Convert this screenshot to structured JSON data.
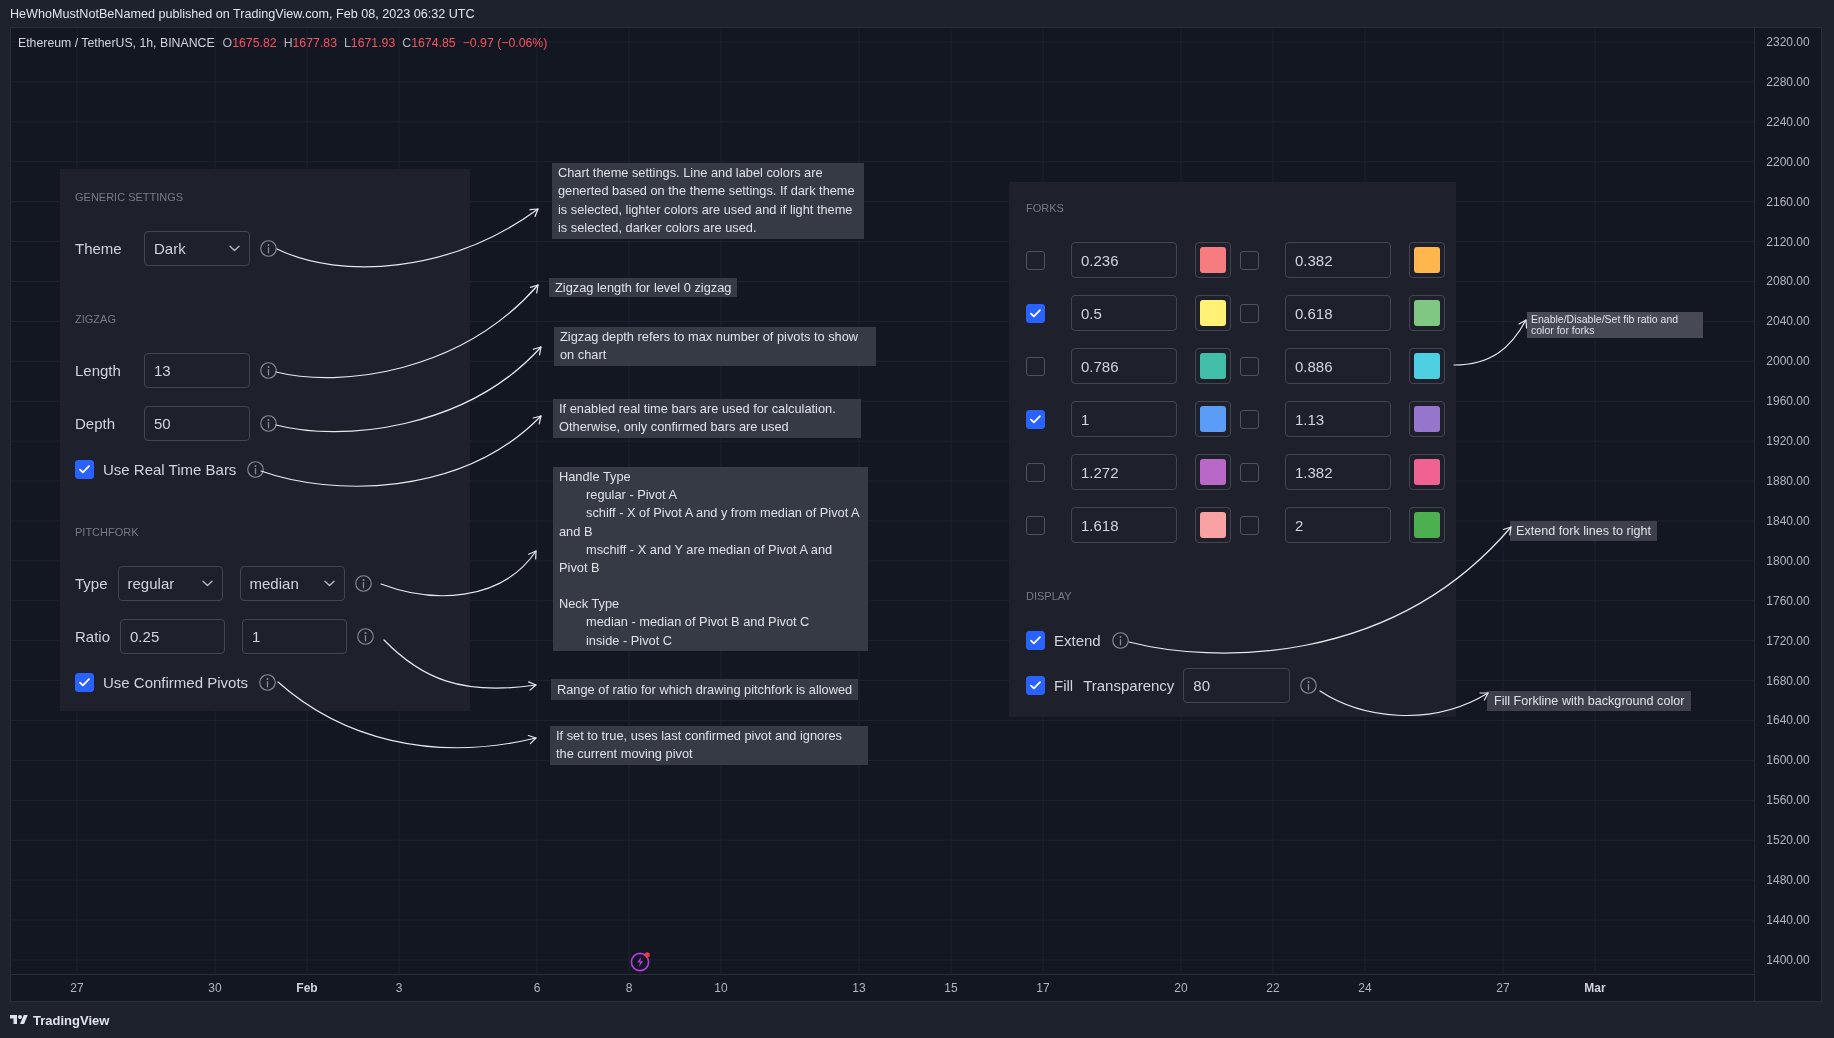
{
  "header": {
    "text": "HeWhoMustNotBeNamed published on TradingView.com, Feb 08, 2023 06:32 UTC"
  },
  "chart": {
    "legend": {
      "symbol": "Ethereum / TetherUS, 1h, BINANCE",
      "values": [
        {
          "label": "O",
          "value": "1675.82"
        },
        {
          "label": "H",
          "value": "1677.83"
        },
        {
          "label": "L",
          "value": "1671.93"
        },
        {
          "label": "C",
          "value": "1674.85"
        }
      ],
      "change": "−0.97 (−0.06%)"
    },
    "settings_panel": {
      "sections": [
        {
          "title": "GENERIC SETTINGS",
          "rows": [
            {
              "kind": "fields",
              "label": "Theme",
              "controls": [
                {
                  "kind": "select",
                  "value": "Dark"
                }
              ]
            }
          ]
        },
        {
          "title": "ZIGZAG",
          "rows": [
            {
              "kind": "fields",
              "label": "Length",
              "controls": [
                {
                  "kind": "input",
                  "value": "13"
                }
              ]
            },
            {
              "kind": "fields",
              "label": "Depth",
              "controls": [
                {
                  "kind": "input",
                  "value": "50"
                }
              ]
            },
            {
              "kind": "checkbox",
              "label": "Use Real Time Bars",
              "checked": true
            }
          ]
        },
        {
          "title": "PITCHFORK",
          "rows": [
            {
              "kind": "fields",
              "label": "Type",
              "controls": [
                {
                  "kind": "select",
                  "value": "regular"
                },
                {
                  "kind": "select",
                  "value": "median"
                }
              ]
            },
            {
              "kind": "fields",
              "label": "Ratio",
              "controls": [
                {
                  "kind": "input",
                  "value": "0.25"
                },
                {
                  "kind": "input",
                  "value": "1"
                }
              ]
            },
            {
              "kind": "checkbox",
              "label": "Use Confirmed Pivots",
              "checked": true
            }
          ]
        }
      ]
    },
    "notes": [
      {
        "kind": "text",
        "text": "Chart theme settings. Line and label colors are generted based on the theme settings. If dark theme is selected, lighter colors are used and if light theme is selected, darker colors are used."
      },
      {
        "kind": "text",
        "text": "Zigzag length for level 0 zigzag"
      },
      {
        "kind": "text",
        "text": "Zigzag depth refers to max number of pivots to show on chart"
      },
      {
        "kind": "text",
        "text": "If enabled real time bars are used for calculation. Otherwise, only confirmed bars are used"
      },
      {
        "kind": "outline",
        "items": [
          {
            "text": "Handle Type",
            "children": [
              {
                "text": "regular - Pivot A"
              },
              {
                "text": "schiff - X of Pivot A and y from median of Pivot A and B"
              },
              {
                "text": "mschiff - X and Y are median of Pivot A and Pivot B"
              }
            ]
          },
          {
            "text": "Neck Type",
            "children": [
              {
                "text": "median - median of Pivot B and Pivot C"
              },
              {
                "text": "inside - Pivot C"
              }
            ]
          }
        ]
      },
      {
        "kind": "text",
        "text": "Range of ratio for which drawing pitchfork is allowed"
      },
      {
        "kind": "text",
        "text": "If set to true, uses last confirmed pivot and ignores the current moving pivot"
      },
      {
        "kind": "text",
        "text": "Enable/Disable/Set fib ratio and color for forks"
      },
      {
        "kind": "text",
        "text": "Extend fork lines to right"
      },
      {
        "kind": "text",
        "text": "Fill Forkline with background color"
      }
    ],
    "forks_panel": {
      "forks": {
        "title": "FORKS",
        "levels": [
          {
            "checked": false,
            "value": "0.236",
            "color": "#f77c80"
          },
          {
            "checked": false,
            "value": "0.382",
            "color": "#ffb74d"
          },
          {
            "checked": true,
            "value": "0.5",
            "color": "#fff176"
          },
          {
            "checked": false,
            "value": "0.618",
            "color": "#81c784"
          },
          {
            "checked": false,
            "value": "0.786",
            "color": "#42bda8"
          },
          {
            "checked": false,
            "value": "0.886",
            "color": "#4dd0e1"
          },
          {
            "checked": true,
            "value": "1",
            "color": "#5b9cf6"
          },
          {
            "checked": false,
            "value": "1.13",
            "color": "#9575cd"
          },
          {
            "checked": false,
            "value": "1.272",
            "color": "#ba68c8"
          },
          {
            "checked": false,
            "value": "1.382",
            "color": "#f06292"
          },
          {
            "checked": false,
            "value": "1.618",
            "color": "#faa1a4"
          },
          {
            "checked": false,
            "value": "2",
            "color": "#4caf50"
          }
        ]
      },
      "display": {
        "title": "DISPLAY",
        "rows": [
          {
            "kind": "checkbox",
            "label": "Extend",
            "checked": true
          },
          {
            "kind": "checkbox_field",
            "label": "Fill",
            "checked": true,
            "field_label": "Transparency",
            "value": "80"
          }
        ]
      }
    },
    "price_axis": [
      "2320.00",
      "2280.00",
      "2240.00",
      "2200.00",
      "2160.00",
      "2120.00",
      "2080.00",
      "2040.00",
      "2000.00",
      "1960.00",
      "1920.00",
      "1880.00",
      "1840.00",
      "1800.00",
      "1760.00",
      "1720.00",
      "1680.00",
      "1640.00",
      "1600.00",
      "1560.00",
      "1520.00",
      "1480.00",
      "1440.00",
      "1400.00"
    ],
    "time_axis": [
      {
        "label": "27",
        "kind": "day"
      },
      {
        "label": "30",
        "kind": "day"
      },
      {
        "label": "Feb",
        "kind": "month"
      },
      {
        "label": "3",
        "kind": "day"
      },
      {
        "label": "6",
        "kind": "day"
      },
      {
        "label": "8",
        "kind": "day"
      },
      {
        "label": "10",
        "kind": "day"
      },
      {
        "label": "13",
        "kind": "day"
      },
      {
        "label": "15",
        "kind": "day"
      },
      {
        "label": "17",
        "kind": "day"
      },
      {
        "label": "20",
        "kind": "day"
      },
      {
        "label": "22",
        "kind": "day"
      },
      {
        "label": "24",
        "kind": "day"
      },
      {
        "label": "27",
        "kind": "day"
      },
      {
        "label": "Mar",
        "kind": "month"
      }
    ]
  },
  "footer": {
    "brand": "TradingView"
  }
}
